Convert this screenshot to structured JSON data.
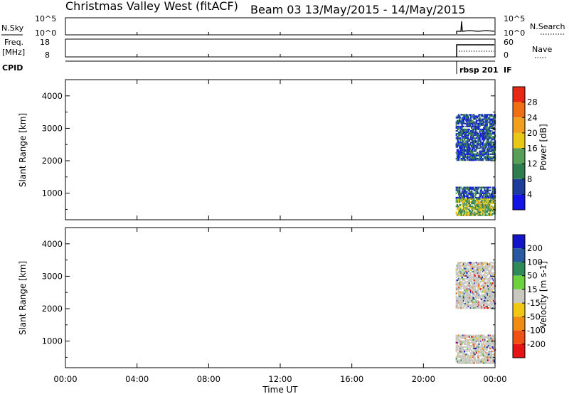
{
  "header": {
    "title": "Christmas Valley West (fitACF)",
    "beam_info": "Beam 03 13/May/2015 - 14/May/2015"
  },
  "summary_panels": {
    "nsky": {
      "label": "N.Sky",
      "ticks": [
        "10^5",
        "10^0"
      ],
      "right_label": "N.Search",
      "right_ticks": [
        "10^5",
        "10^0"
      ]
    },
    "freq": {
      "label_line1": "Freq.",
      "label_line2": "[MHz]",
      "ticks": [
        "18",
        "8"
      ],
      "right_label": "Nave",
      "right_ticks": [
        "60",
        "0"
      ]
    },
    "cpid": {
      "label": "CPID",
      "mode_text": "rbsp 201",
      "if_text": "IF"
    }
  },
  "time_axis": {
    "label": "Time UT",
    "ticks": [
      "00:00",
      "04:00",
      "08:00",
      "12:00",
      "16:00",
      "20:00",
      "00:00"
    ]
  },
  "colors": {
    "power": [
      "#1414e6",
      "#1e3c9c",
      "#2e7d4f",
      "#58a05a",
      "#e8c814",
      "#f0a01e",
      "#f06e14",
      "#e62814"
    ],
    "velocity": [
      "#1414c8",
      "#285aa0",
      "#2e8b57",
      "#6ed23c",
      "#c8c8c0",
      "#f0c814",
      "#f08c14",
      "#f05014",
      "#e61414"
    ],
    "ground_scatter": "#c8c8c0"
  },
  "chart_data": [
    {
      "type": "heatmap",
      "name": "power",
      "ylabel": "Slant Range [km]",
      "xlabel": "Time UT",
      "xlim_hours": [
        0,
        24
      ],
      "ylim": [
        180,
        4500
      ],
      "yticks": [
        1000,
        2000,
        3000,
        4000
      ],
      "colorbar": {
        "label": "Power [dB]",
        "ticks": [
          "4",
          "8",
          "12",
          "16",
          "20",
          "24",
          "28"
        ],
        "range": [
          0,
          32
        ]
      },
      "regions": [
        {
          "t_start": 21.8,
          "t_end": 24.0,
          "range_start": 2000,
          "range_end": 3400,
          "value_mean": 12
        },
        {
          "t_start": 21.8,
          "t_end": 24.0,
          "range_start": 300,
          "range_end": 1200,
          "value_mean": 10
        }
      ]
    },
    {
      "type": "heatmap",
      "name": "velocity",
      "ylabel": "Slant Range [km]",
      "xlabel": "Time UT",
      "xlim_hours": [
        0,
        24
      ],
      "ylim": [
        180,
        4500
      ],
      "yticks": [
        1000,
        2000,
        3000,
        4000
      ],
      "colorbar": {
        "label": "Velocity [m s-1]",
        "ticks": [
          "200",
          "100",
          "50",
          "15",
          "-15",
          "-50",
          "-100",
          "-200"
        ],
        "range": [
          -250,
          250
        ]
      },
      "regions": [
        {
          "t_start": 21.8,
          "t_end": 24.0,
          "range_start": 2000,
          "range_end": 3400,
          "value_mean": 0
        },
        {
          "t_start": 21.8,
          "t_end": 24.0,
          "range_start": 300,
          "range_end": 1200,
          "value_mean": 0
        }
      ]
    }
  ]
}
